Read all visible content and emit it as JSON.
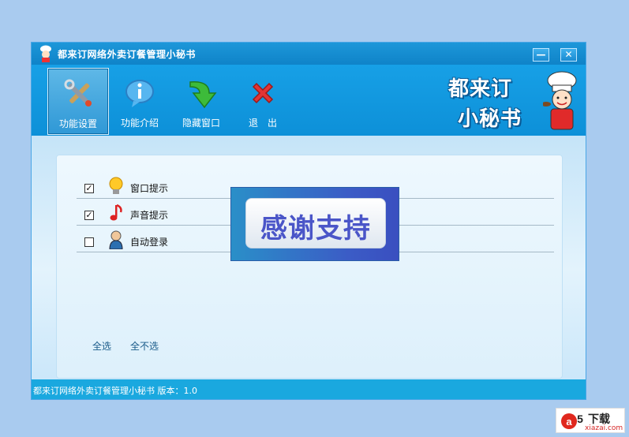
{
  "window": {
    "title": "都来订网络外卖订餐管理小秘书",
    "min_label": "—",
    "close_label": "✕"
  },
  "toolbar": {
    "items": [
      {
        "label": "功能设置",
        "icon": "tools-icon",
        "active": true
      },
      {
        "label": "功能介绍",
        "icon": "info-icon",
        "active": false
      },
      {
        "label": "隐藏窗口",
        "icon": "down-arrow-icon",
        "active": false
      },
      {
        "label": "退　出",
        "icon": "exit-x-icon",
        "active": false
      }
    ],
    "brand": {
      "line1": "都来订",
      "line2": "小秘书"
    }
  },
  "settings": {
    "rows": [
      {
        "label": "窗口提示",
        "checked": true,
        "checkmark": "✓",
        "icon": "bulb-icon"
      },
      {
        "label": "声音提示",
        "checked": true,
        "checkmark": "✓",
        "icon": "music-note-icon"
      },
      {
        "label": "自动登录",
        "checked": false,
        "checkmark": "",
        "icon": "user-icon"
      }
    ],
    "select_all": "全选",
    "select_none": "全不选"
  },
  "overlay": {
    "text": "感谢支持"
  },
  "status": {
    "text": "都来订网络外卖订餐管理小秘书  版本：1.0"
  },
  "watermark": {
    "dl": "下载",
    "url": "xiazai.com"
  },
  "colors": {
    "accent": "#1aa8df",
    "toolbar": "#0d90d8",
    "background": "#a9cbef"
  }
}
